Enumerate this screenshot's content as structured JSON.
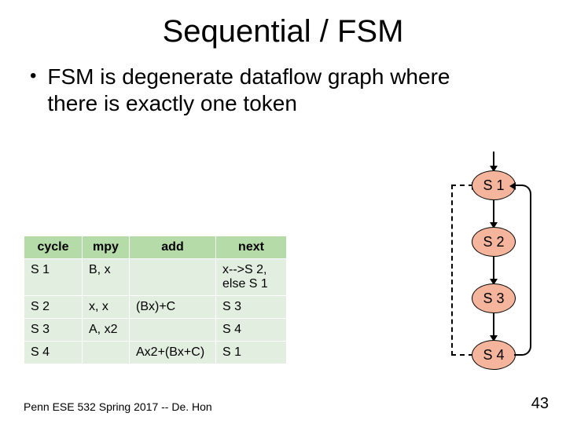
{
  "title": "Sequential / FSM",
  "bullet": "FSM is degenerate dataflow graph where there is exactly one token",
  "table": {
    "headers": {
      "cycle": "cycle",
      "mpy": "mpy",
      "add": "add",
      "next": "next"
    },
    "rows": [
      {
        "cycle": "S 1",
        "mpy": "B, x",
        "add": "",
        "next": "x-->S 2, else S 1"
      },
      {
        "cycle": "S 2",
        "mpy": "x, x",
        "add": "(Bx)+C",
        "next": "S 3"
      },
      {
        "cycle": "S 3",
        "mpy": "A, x2",
        "add": "",
        "next": "S 4"
      },
      {
        "cycle": "S 4",
        "mpy": "",
        "add": "Ax2+(Bx+C)",
        "next": "S 1"
      }
    ]
  },
  "nodes": {
    "n1": "S 1",
    "n2": "S 2",
    "n3": "S 3",
    "n4": "S 4"
  },
  "footer": "Penn ESE 532 Spring 2017 -- De. Hon",
  "page": "43"
}
